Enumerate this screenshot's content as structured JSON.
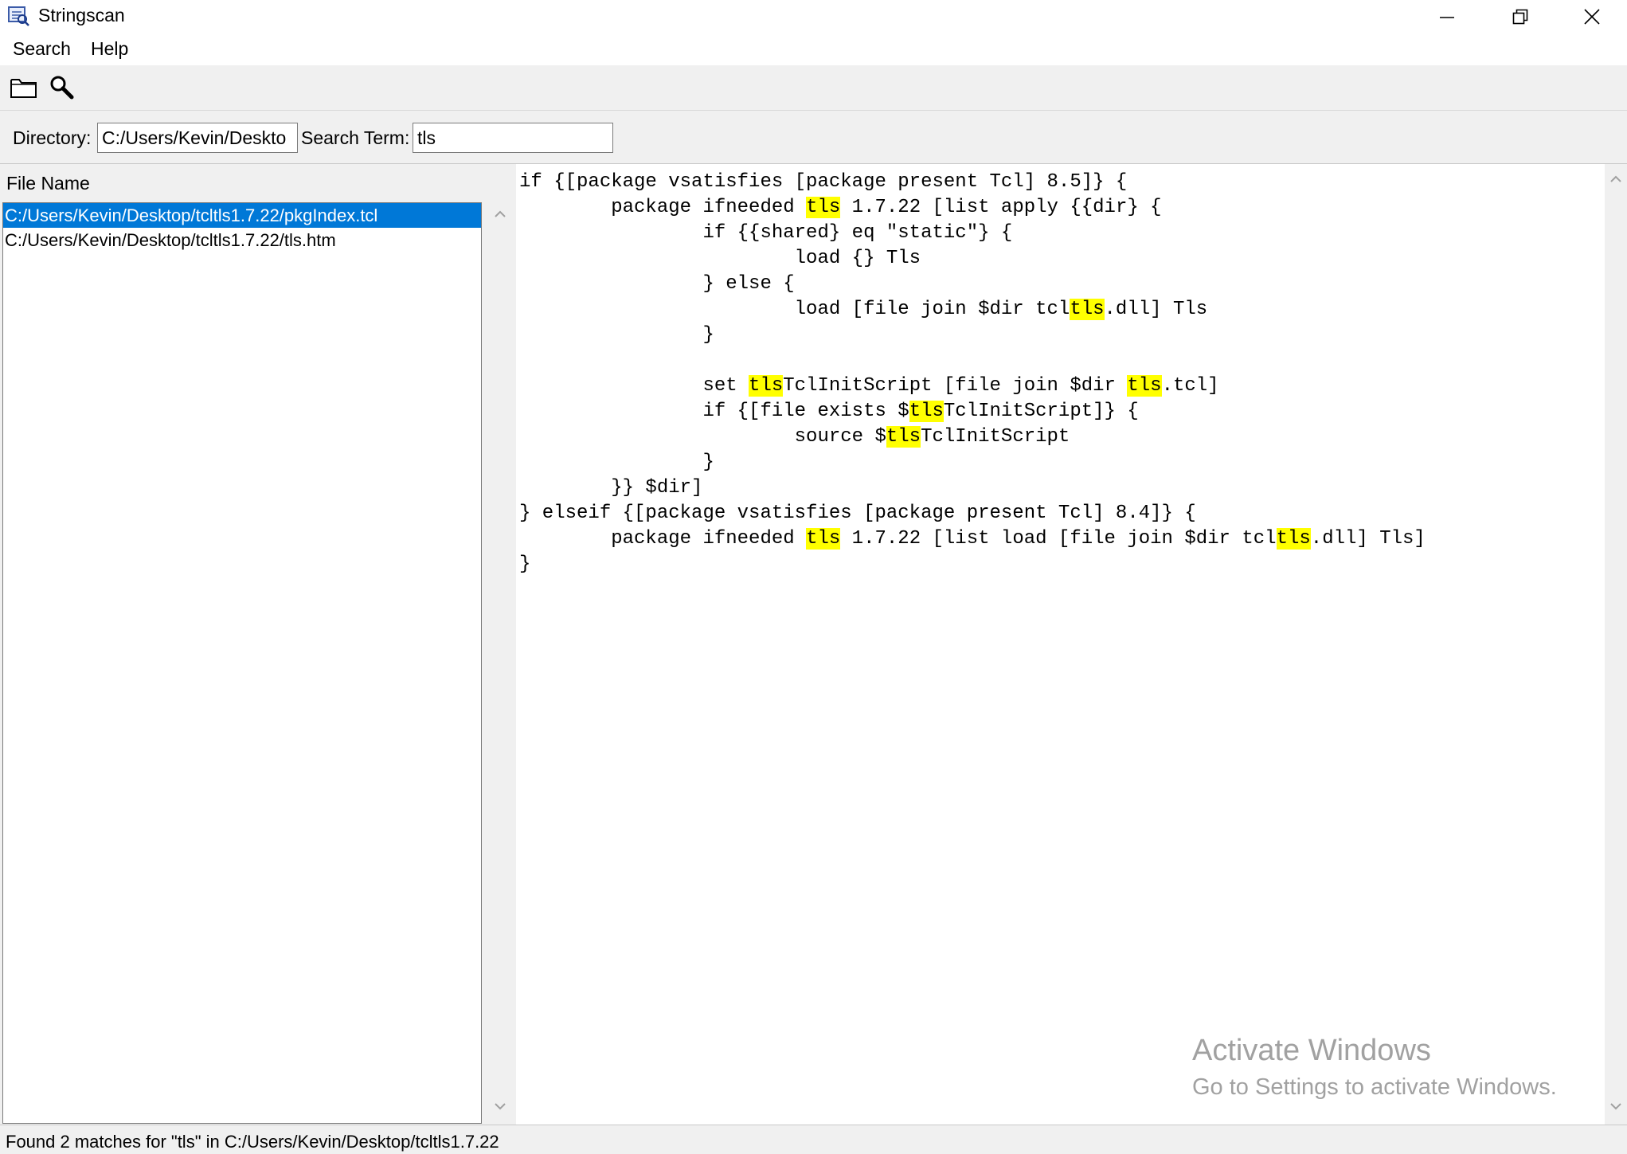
{
  "window": {
    "title": "Stringscan",
    "controls": {
      "minimize": "minimize-icon",
      "maximize": "restore-icon",
      "close": "close-icon"
    }
  },
  "menu": {
    "items": [
      "Search",
      "Help"
    ]
  },
  "toolbar": {
    "icons": [
      "folder-icon",
      "search-icon"
    ]
  },
  "search": {
    "directory_label": "Directory:",
    "directory_value": "C:/Users/Kevin/Deskto",
    "term_label": "Search Term:",
    "term_value": "tls"
  },
  "file_panel": {
    "header": "File Name",
    "files": [
      {
        "path": "C:/Users/Kevin/Desktop/tcltls1.7.22/pkgIndex.tcl",
        "selected": true
      },
      {
        "path": "C:/Users/Kevin/Desktop/tcltls1.7.22/tls.htm",
        "selected": false
      }
    ]
  },
  "code": {
    "highlight_color": "#ffff00",
    "lines": [
      "if {[package vsatisfies [package present Tcl] 8.5]} {",
      "\tpackage ifneeded tls 1.7.22 [list apply {{dir} {",
      "\t\tif {{shared} eq \"static\"} {",
      "\t\t\tload {} Tls",
      "\t\t} else {",
      "\t\t\tload [file join $dir tcltls.dll] Tls",
      "\t\t}",
      "",
      "\t\tset tlsTclInitScript [file join $dir tls.tcl]",
      "\t\tif {[file exists $tlsTclInitScript]} {",
      "\t\t\tsource $tlsTclInitScript",
      "\t\t}",
      "\t}} $dir]",
      "} elseif {[package vsatisfies [package present Tcl] 8.4]} {",
      "\tpackage ifneeded tls 1.7.22 [list load [file join $dir tcltls.dll] Tls]",
      "}"
    ]
  },
  "watermark": {
    "line1": "Activate Windows",
    "line2": "Go to Settings to activate Windows."
  },
  "status": {
    "text": "Found 2 matches for \"tls\" in C:/Users/Kevin/Desktop/tcltls1.7.22"
  },
  "colors": {
    "selection": "#0078d7",
    "highlight": "#ffff00"
  }
}
